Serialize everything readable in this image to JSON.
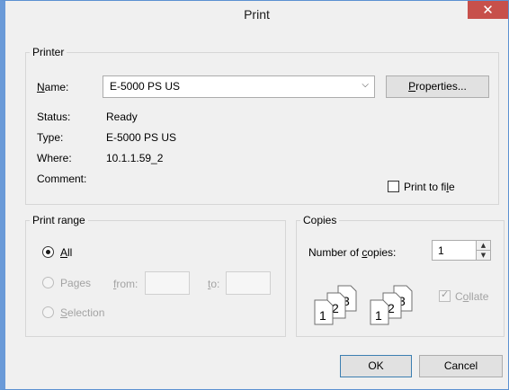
{
  "window": {
    "title": "Print",
    "close_glyph": "✕"
  },
  "printer": {
    "legend": "Printer",
    "name_label_u": "N",
    "name_label_rest": "ame:",
    "name_value": "E-5000 PS US",
    "properties_u": "P",
    "properties_rest": "roperties...",
    "status_label": "Status:",
    "status_value": "Ready",
    "type_label": "Type:",
    "type_value": "E-5000 PS US",
    "where_label": "Where:",
    "where_value": "10.1.1.59_2",
    "comment_label": "Comment:",
    "print_to_file_pre": "Print to fi",
    "print_to_file_u": "l",
    "print_to_file_post": "e",
    "print_to_file_checked": false
  },
  "print_range": {
    "legend": "Print range",
    "all_u": "A",
    "all_rest": "ll",
    "pages_pre": "Pa",
    "pages_u": "g",
    "pages_post": "es",
    "from_u": "f",
    "from_rest": "rom:",
    "to_u": "t",
    "to_rest": "o:",
    "selection_u": "S",
    "selection_rest": "election",
    "selected": "All"
  },
  "copies": {
    "legend": "Copies",
    "num_label_pre": "Number of ",
    "num_label_u": "c",
    "num_label_post": "opies:",
    "num_value": "1",
    "collate_pre": "C",
    "collate_u": "o",
    "collate_post": "llate",
    "collate_checked": true,
    "page_numbers": [
      "1",
      "2",
      "3"
    ]
  },
  "buttons": {
    "ok": "OK",
    "cancel": "Cancel"
  }
}
